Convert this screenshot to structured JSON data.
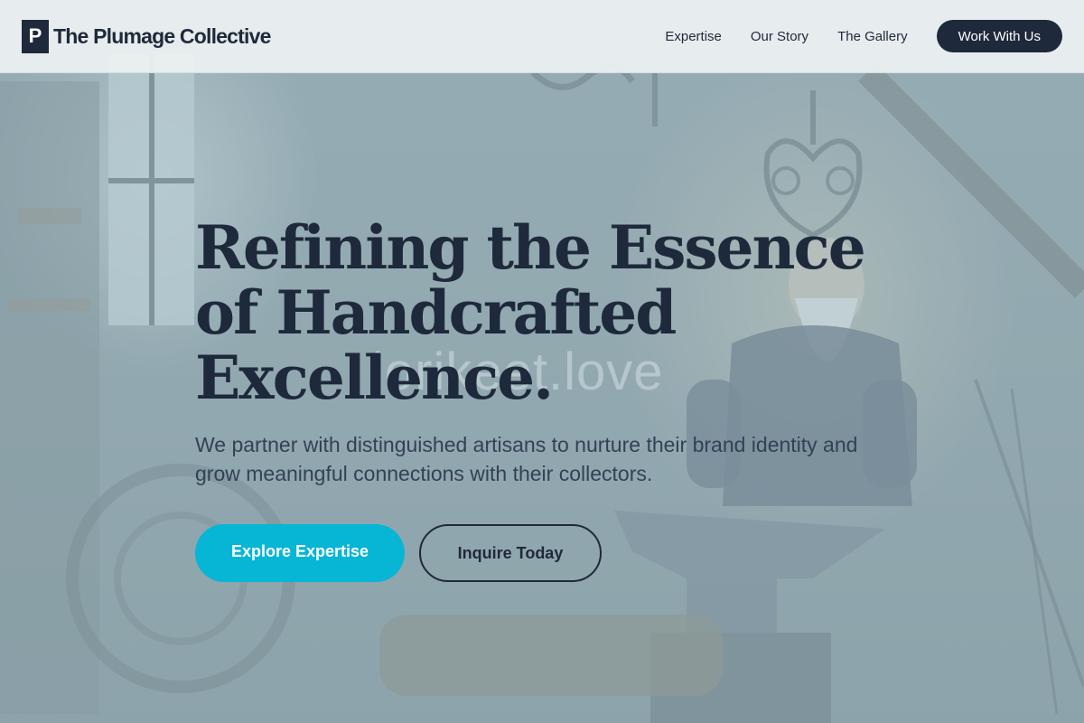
{
  "header": {
    "brand_mark": "P",
    "brand_name": "The Plumage Collective",
    "nav": [
      "Expertise",
      "Our Story",
      "The Gallery"
    ],
    "cta": "Work With Us"
  },
  "hero": {
    "title": "Refining the Essence of Handcrafted Excellence.",
    "subtitle": "We partner with distinguished artisans to nurture their brand identity and grow meaningful connections with their collectors.",
    "primary_button": "Explore Expertise",
    "secondary_button": "Inquire Today",
    "watermark": "lorikeet.love",
    "background_image": "blacksmith-workshop"
  },
  "colors": {
    "primary": "#1e293b",
    "accent": "#06b6d4",
    "header_bg": "#eceff1",
    "overlay": "#aac4d0"
  }
}
